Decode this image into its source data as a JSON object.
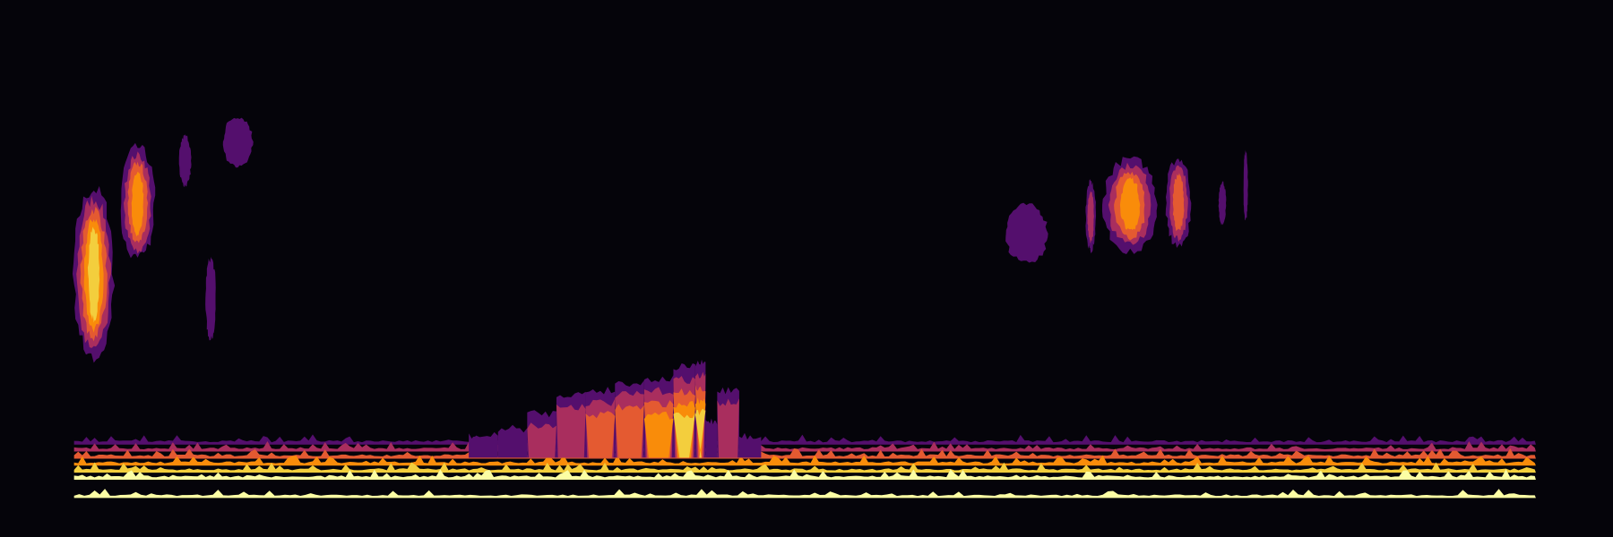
{
  "chart_data": {
    "type": "heatmap",
    "style": "filled contour, inferno colormap, no axes, no labels",
    "grid": false,
    "legend": "none",
    "xlim": [
      0,
      1000
    ],
    "ylim": [
      0,
      100
    ],
    "background": "#05040a",
    "level_colors": [
      "#540f6d",
      "#a92e5e",
      "#e45a31",
      "#f98c0a",
      "#f3ce3d",
      "#fcfea4"
    ],
    "blobs": [
      {
        "t": [
          0,
          27
        ],
        "f": [
          36,
          80
        ],
        "level": 5
      },
      {
        "t": [
          32,
          55
        ],
        "f": [
          62,
          91
        ],
        "level": 4
      },
      {
        "t": [
          72,
          80
        ],
        "f": [
          81,
          94
        ],
        "level": 1
      },
      {
        "t": [
          102,
          122
        ],
        "f": [
          86,
          99
        ],
        "level": 1
      },
      {
        "t": [
          90,
          97
        ],
        "f": [
          41,
          62
        ],
        "level": 1
      },
      {
        "t": [
          637,
          666
        ],
        "f": [
          61,
          76
        ],
        "level": 1
      },
      {
        "t": [
          692,
          699
        ],
        "f": [
          64,
          82
        ],
        "level": 2
      },
      {
        "t": [
          704,
          741
        ],
        "f": [
          64,
          88
        ],
        "level": 4
      },
      {
        "t": [
          747,
          764
        ],
        "f": [
          65,
          88
        ],
        "level": 3
      },
      {
        "t": [
          783,
          788
        ],
        "f": [
          71,
          82
        ],
        "level": 1
      },
      {
        "t": [
          800,
          803
        ],
        "f": [
          72,
          90
        ],
        "level": 1
      }
    ],
    "ridge": {
      "t": [
        270,
        290,
        310,
        330,
        350,
        370,
        390,
        410,
        425,
        432,
        440,
        455,
        470
      ],
      "f_top": [
        16,
        18,
        22,
        27,
        28,
        30,
        31,
        34,
        35,
        20,
        28,
        16,
        13
      ],
      "level": [
        1,
        1,
        2,
        2,
        3,
        3,
        4,
        5,
        5,
        1,
        2,
        1,
        1
      ]
    },
    "base_band": {
      "f": [
        3,
        14
      ],
      "levels": 6
    }
  }
}
